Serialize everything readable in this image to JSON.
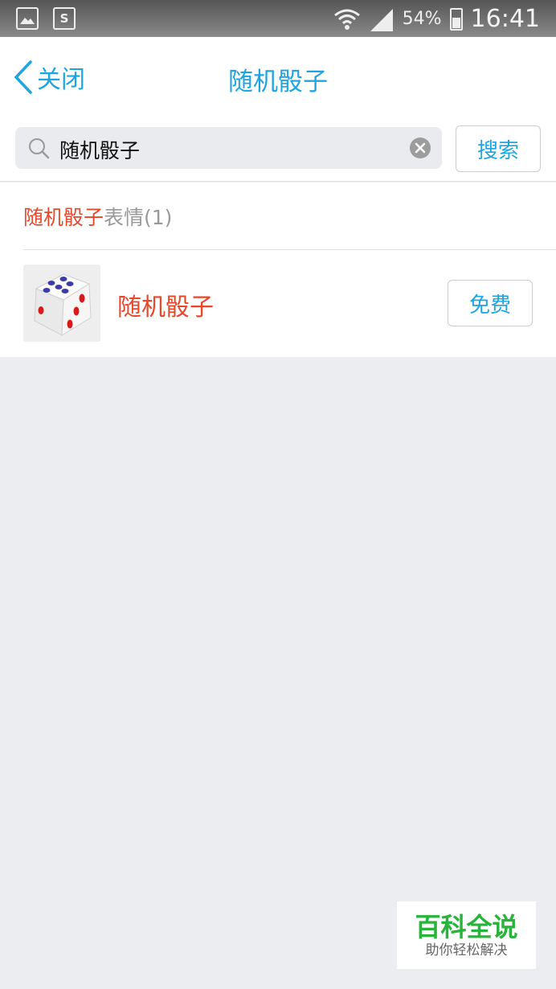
{
  "status_bar": {
    "battery_percent": "54%",
    "time": "16:41",
    "left_icons": [
      "image-icon",
      "s-app-icon"
    ],
    "right_icons": [
      "wifi-icon",
      "signal-icon",
      "battery-icon"
    ]
  },
  "nav": {
    "back_label": "关闭",
    "title": "随机骰子"
  },
  "search": {
    "value": "随机骰子",
    "button_label": "搜索"
  },
  "results": {
    "header_keyword": "随机骰子",
    "header_suffix": "表情(1)",
    "items": [
      {
        "name": "随机骰子",
        "action_label": "免费"
      }
    ]
  },
  "watermark": {
    "main": "百科全说",
    "sub": "助你轻松解决"
  },
  "colors": {
    "accent": "#1fa4e2",
    "highlight": "#e8472a",
    "background": "#ebedf1"
  }
}
